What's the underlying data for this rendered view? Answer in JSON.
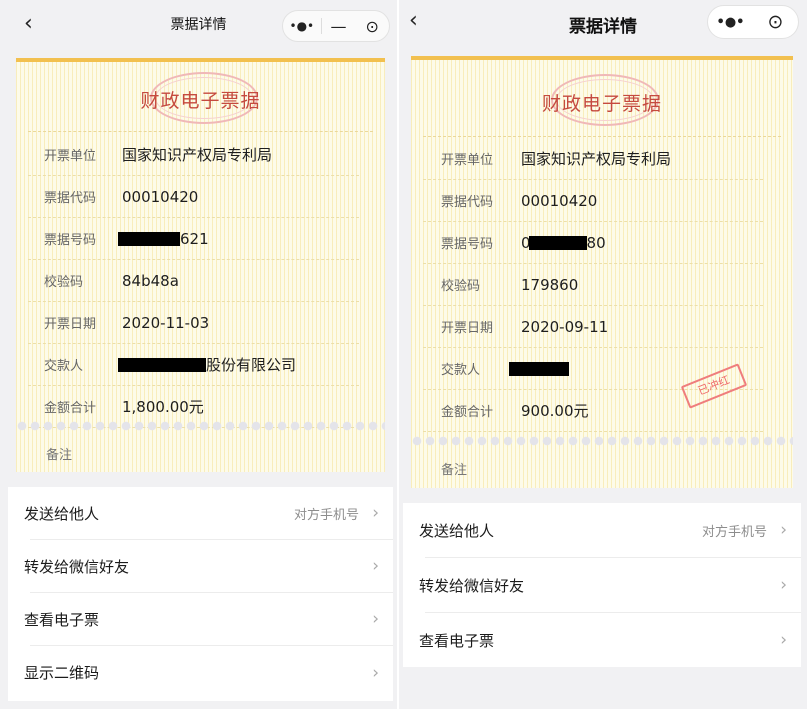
{
  "left": {
    "nav": {
      "back_icon": "‹",
      "title": "票据详情"
    },
    "receipt": {
      "title": "财政电子票据",
      "rows": [
        {
          "label": "开票单位",
          "value": "国家知识产权局专利局"
        },
        {
          "label": "票据代码",
          "value": "00010420"
        },
        {
          "label": "票据号码",
          "value": "621"
        },
        {
          "label": "校验码",
          "value": "84b48a"
        },
        {
          "label": "开票日期",
          "value": "2020-11-03"
        },
        {
          "label": "交款人",
          "value": "股份有限公司"
        },
        {
          "label": "金额合计",
          "value": "1,800.00元"
        }
      ],
      "remark_label": "备注"
    },
    "menu": [
      {
        "label": "发送给他人",
        "hint": "对方手机号"
      },
      {
        "label": "转发给微信好友"
      },
      {
        "label": "查看电子票"
      },
      {
        "label": "显示二维码"
      }
    ]
  },
  "right": {
    "nav": {
      "back_icon": "‹",
      "title": "票据详情"
    },
    "receipt": {
      "title": "财政电子票据",
      "rows": [
        {
          "label": "开票单位",
          "value": "国家知识产权局专利局"
        },
        {
          "label": "票据代码",
          "value": "00010420"
        },
        {
          "label": "票据号码",
          "value_prefix": "0",
          "value_suffix": "80"
        },
        {
          "label": "校验码",
          "value": "179860"
        },
        {
          "label": "开票日期",
          "value": "2020-09-11"
        },
        {
          "label": "交款人",
          "value": ""
        },
        {
          "label": "金额合计",
          "value": "900.00元"
        }
      ],
      "stamp": "已冲红",
      "remark_label": "备注"
    },
    "menu": [
      {
        "label": "发送给他人",
        "hint": "对方手机号"
      },
      {
        "label": "转发给微信好友"
      },
      {
        "label": "查看电子票"
      }
    ]
  },
  "chevron": "›",
  "icons": [
    "back-icon",
    "more-dots-icon",
    "minimize-icon",
    "target-circle-icon",
    "chevron-right-icon"
  ]
}
